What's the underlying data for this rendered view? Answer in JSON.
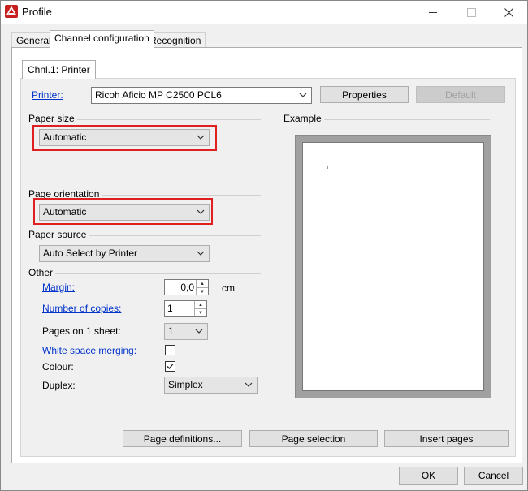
{
  "window": {
    "title": "Profile",
    "minimize": "—",
    "maximize": "☐",
    "close": "✕"
  },
  "tabs": [
    {
      "label": "General"
    },
    {
      "label": "Channel configuration"
    },
    {
      "label": "Recognition"
    }
  ],
  "subtab": {
    "label": "Chnl.1: Printer"
  },
  "printer": {
    "label": "Printer:",
    "value": "Ricoh Aficio MP C2500 PCL6",
    "properties_label": "Properties",
    "default_label": "Default"
  },
  "paper_size": {
    "label": "Paper size",
    "value": "Automatic"
  },
  "page_orientation": {
    "label": "Page orientation",
    "value": "Automatic"
  },
  "paper_source": {
    "label": "Paper source",
    "value": "Auto Select by Printer"
  },
  "other": {
    "label": "Other",
    "margin_label": "Margin:",
    "margin_value": "0,0",
    "margin_unit": "cm",
    "copies_label": "Number of copies:",
    "copies_value": "1",
    "pages_label": "Pages on 1 sheet:",
    "pages_value": "1",
    "whitespace_label": "White space merging:",
    "whitespace_checked": false,
    "colour_label": "Colour:",
    "colour_checked": true,
    "duplex_label": "Duplex:",
    "duplex_value": "Simplex"
  },
  "example": {
    "label": "Example"
  },
  "actions": {
    "page_definitions": "Page definitions...",
    "page_selection": "Page selection",
    "insert_pages": "Insert pages"
  },
  "dialog": {
    "ok": "OK",
    "cancel": "Cancel"
  },
  "colors": {
    "highlight": "#e0201f",
    "link": "#0033cc"
  }
}
